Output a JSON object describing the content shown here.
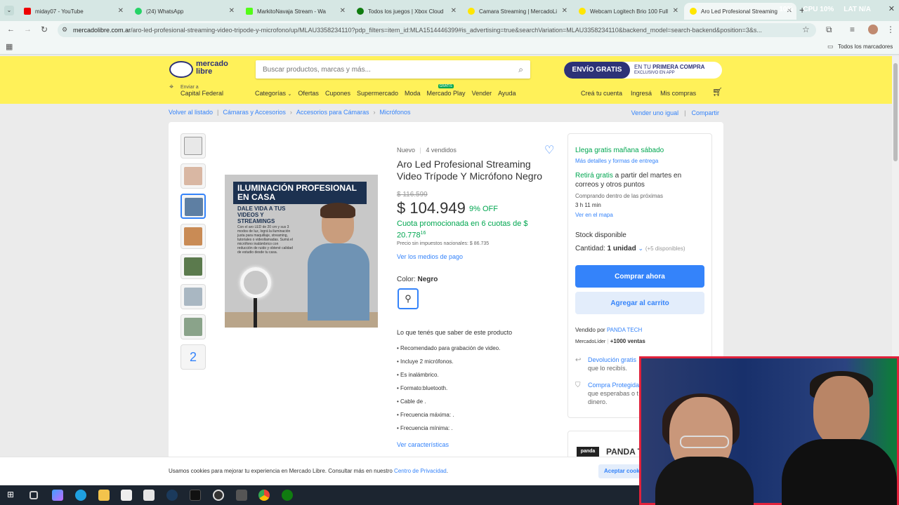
{
  "browser": {
    "tabs": [
      {
        "label": "miday07 - YouTube",
        "color": "#e00"
      },
      {
        "label": "(24) WhatsApp",
        "color": "#25d366"
      },
      {
        "label": "MarkitoNavaja Stream - Wa",
        "color": "#53fc18"
      },
      {
        "label": "Todos los juegos | Xbox Cloud",
        "color": "#107c10"
      },
      {
        "label": "Camara Streaming | MercadoLi",
        "color": "#ffe600"
      },
      {
        "label": "Webcam Logitech Brio 100 Full",
        "color": "#ffe600"
      },
      {
        "label": "Aro Led Profesional Streaming",
        "color": "#ffe600"
      }
    ],
    "sys_cpu": "CPU 10%",
    "sys_lat": "LAT N/A",
    "sys_gpu": "10%",
    "url_host": "mercadolibre.com.ar",
    "url_path": "/aro-led-profesional-streaming-video-tripode-y-microfono/up/MLAU3358234110?pdp_filters=item_id:MLA1514446399#is_advertising=true&searchVariation=MLAU3358234110&backend_model=search-backend&position=3&s...",
    "bookmarks_label": "Todos los marcadores"
  },
  "header": {
    "logo_line1": "mercado",
    "logo_line2": "libre",
    "search_placeholder": "Buscar productos, marcas y más...",
    "promo_main": "ENVÍO GRATIS",
    "promo_line1_a": "EN TU ",
    "promo_line1_b": "PRIMERA COMPRA",
    "promo_line2": "EXCLUSIVO EN APP",
    "location_small": "Enviar a",
    "location_big": "Capital Federal",
    "nav": [
      "Categorías",
      "Ofertas",
      "Cupones",
      "Supermercado",
      "Moda",
      "Mercado Play",
      "Vender",
      "Ayuda"
    ],
    "nav_badge": "GRATIS",
    "right_nav": [
      "Creá tu cuenta",
      "Ingresá",
      "Mis compras"
    ]
  },
  "breadcrumb": {
    "back": "Volver al listado",
    "items": [
      "Cámaras y Accesorios",
      "Accesorios para Cámaras",
      "Micrófonos"
    ],
    "sell_same": "Vender uno igual",
    "share": "Compartir"
  },
  "product": {
    "condition": "Nuevo",
    "sold": "4 vendidos",
    "title": "Aro Led Profesional Streaming Video Trípode Y Micrófono Negro",
    "old_price": "$ 116.599",
    "price": "$ 104.949",
    "discount": "9% OFF",
    "installments": "Cuota promocionada en 6 cuotas de $ 20.778",
    "installments_sup": "16",
    "no_tax": "Precio sin impuestos nacionales: $ 86.735",
    "payment_link": "Ver los medios de pago",
    "color_label": "Color:",
    "color_value": "Negro",
    "know_title": "Lo que tenés que saber de este producto",
    "bullets": [
      "Recomendado para grabación de video.",
      "Incluye 2 micrófonos.",
      "Es inalámbrico.",
      "Formato:bluetooth.",
      "Cable de .",
      "Frecuencia máxima: .",
      "Frecuencia mínima: ."
    ],
    "see_features": "Ver características",
    "more_images": "2",
    "image": {
      "headline1": "ILUMINACIÓN PROFESIONAL",
      "headline2": "EN CASA",
      "sub": "DALE VIDA A TUS VIDEOS Y STREAMINGS",
      "body": "Con el aro LED de 20 cm y sus 3 modos de luz, lográ la iluminación justa para maquillaje, streaming, tutoriales o videollamadas. Sumá el micrófono inalámbrico con reducción de ruido y obtené calidad de estudio desde tu casa."
    }
  },
  "sidebar": {
    "ship_free": "Llega gratis mañana sábado",
    "ship_more": "Más detalles y formas de entrega",
    "pickup_a": "Retirá gratis",
    "pickup_b": " a partir del martes en correos y otros puntos",
    "buy_within": "Comprando dentro de las próximas",
    "time_left": "3 h 11 min",
    "see_map": "Ver en el mapa",
    "stock": "Stock disponible",
    "qty_label": "Cantidad: ",
    "qty_value": "1 unidad",
    "qty_avail": "(+5 disponibles)",
    "buy_now": "Comprar ahora",
    "add_cart": "Agregar al carrito",
    "sold_by": "Vendido por ",
    "seller": "PANDA TECH",
    "seller_level": "MercadoLíder",
    "seller_sales": "+1000 ventas",
    "return_free": "Devolución gratis",
    "return_sub": "que lo recibís.",
    "protected": "Compra Protegida",
    "protected_sub": "que esperabas o t",
    "protected_sub2": "dinero.",
    "seller_card": "PANDA T",
    "seller_logo": "panda"
  },
  "cookie": {
    "text": "Usamos cookies para mejorar tu experiencia en Mercado Libre. Consultar más en nuestro ",
    "link": "Centro de Privacidad",
    "accept": "Aceptar cook"
  }
}
